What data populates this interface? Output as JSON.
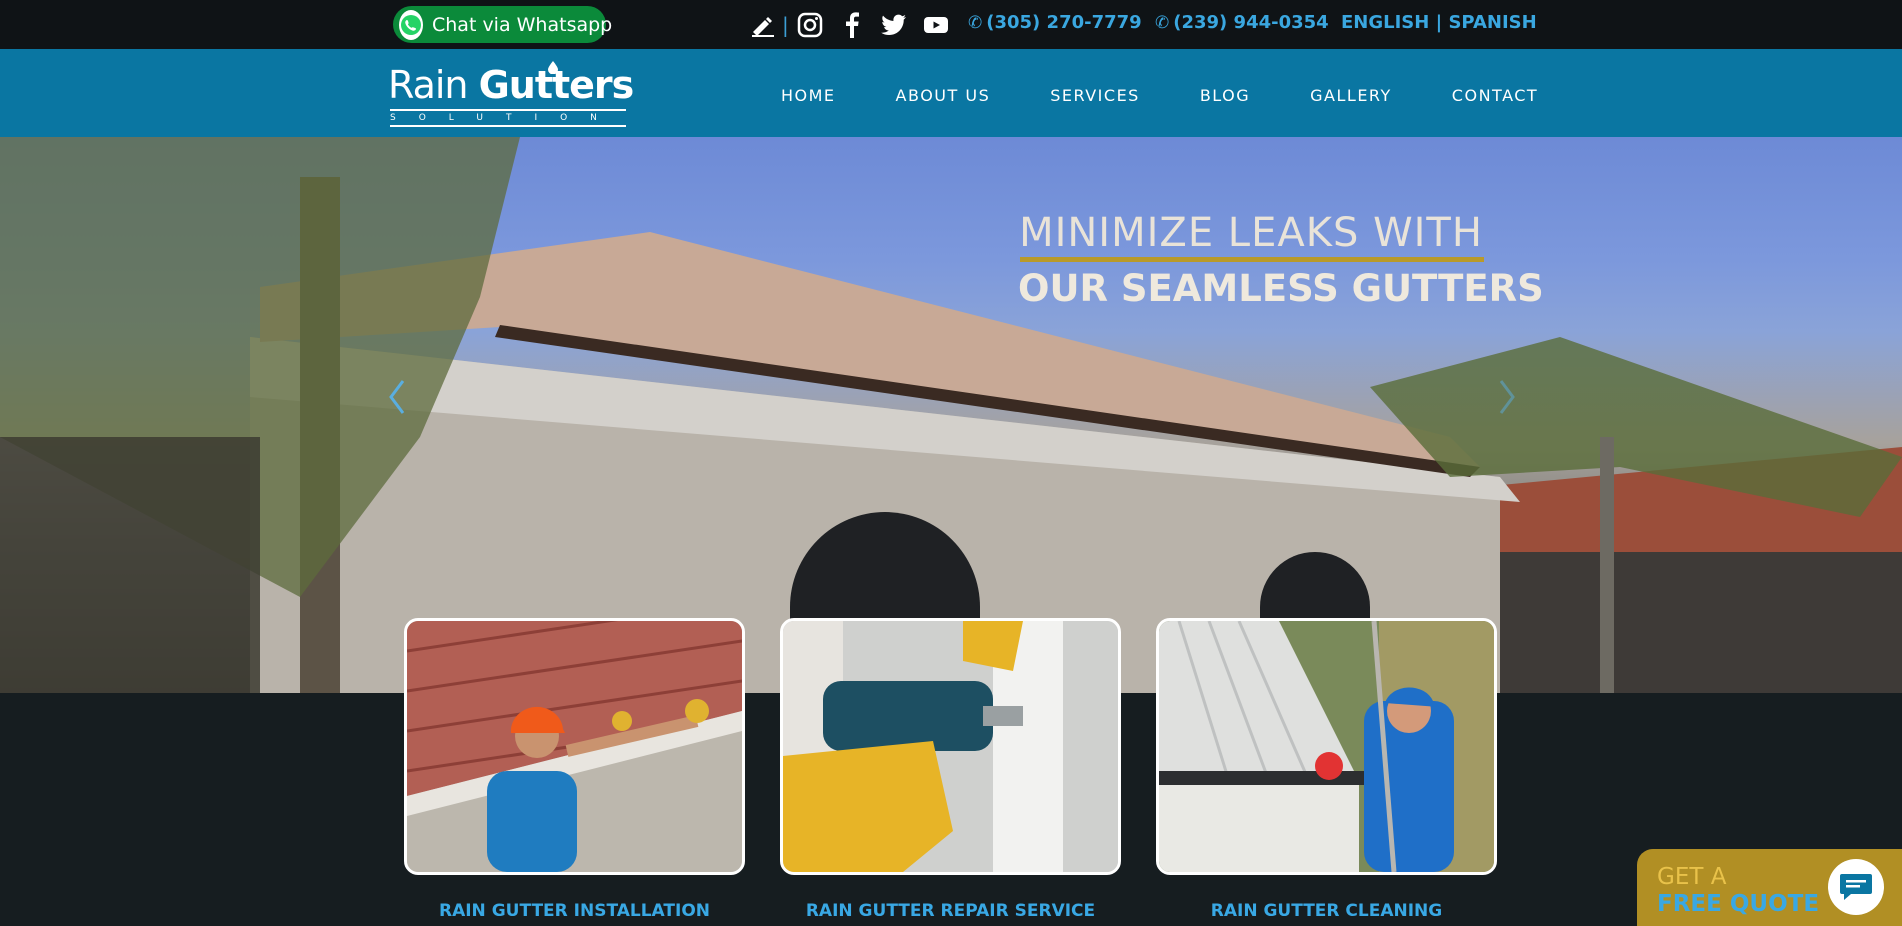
{
  "topbar": {
    "whatsapp_label": "Chat via Whatsapp",
    "separator": "|",
    "icons": [
      "edit-icon",
      "instagram-icon",
      "facebook-icon",
      "twitter-icon",
      "youtube-icon"
    ],
    "phones": [
      "(305) 270-7779",
      "(239) 944-0354"
    ],
    "phone_icon": "phone-icon",
    "lang_english": "ENGLISH",
    "lang_divider": " | ",
    "lang_spanish": "SPANISH"
  },
  "logo": {
    "rain": "Rain ",
    "gutters": "Gutters",
    "sub": "SOLUTION"
  },
  "nav": {
    "items": [
      "HOME",
      "ABOUT US",
      "SERVICES",
      "BLOG",
      "GALLERY",
      "CONTACT"
    ]
  },
  "hero": {
    "headline_line1": "MINIMIZE LEAKS WITH",
    "headline_line2": "OUR SEAMLESS GUTTERS"
  },
  "services": [
    {
      "title": "RAIN GUTTER INSTALLATION"
    },
    {
      "title": "RAIN GUTTER REPAIR SERVICE"
    },
    {
      "title": "RAIN GUTTER CLEANING"
    }
  ],
  "quote": {
    "line1": "GET A",
    "line2": "FREE QUOTE"
  },
  "colors": {
    "topbar": "#0f1316",
    "navbar": "#0a76a2",
    "accent_blue": "#39a8e4",
    "whatsapp_green": "#0b8a3a",
    "quote_gold": "#b18f24",
    "page_bg": "#161d20"
  }
}
